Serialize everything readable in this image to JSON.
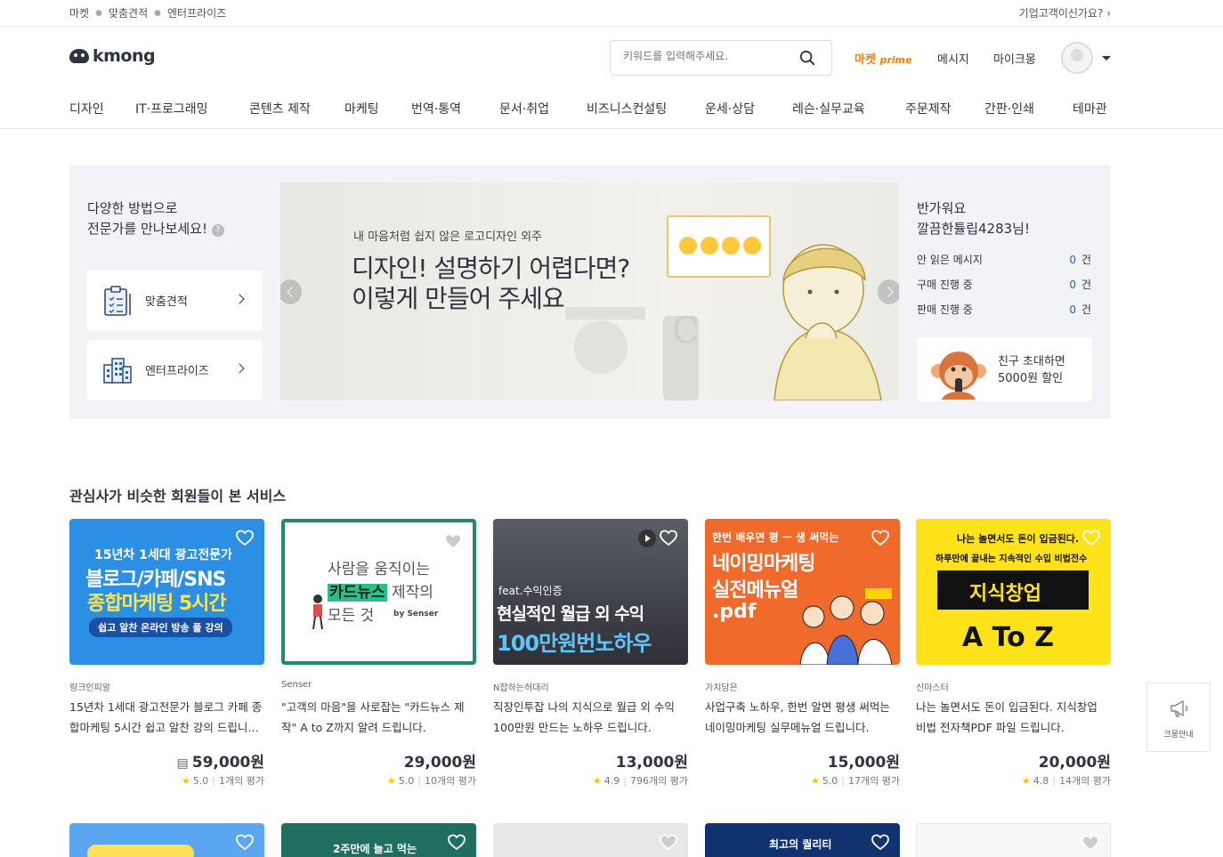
{
  "topbar": {
    "crumbs": [
      "마켓",
      "맞춤견적",
      "엔터프라이즈"
    ],
    "enterprise_q": "기업고객이신가요?"
  },
  "header": {
    "logo": "kmong",
    "search_placeholder": "키워드를 입력해주세요.",
    "market": "마켓",
    "prime": "prime",
    "messages": "메시지",
    "mykmong": "마이크몽"
  },
  "categories": [
    "디자인",
    "IT·프로그래밍",
    "콘텐츠 제작",
    "마케팅",
    "번역·통역",
    "문서·취업",
    "비즈니스컨설팅",
    "운세·상담",
    "레슨·실무교육",
    "주문제작",
    "간판·인쇄",
    "테마관"
  ],
  "hero": {
    "left_title_1": "다양한 방법으로",
    "left_title_2": "전문가를 만나보세요!",
    "help": "?",
    "quick1": "맞춤견적",
    "quick2": "엔터프라이즈",
    "banner_sub": "내 마음처럼 쉽지 않은 로고디자인 외주",
    "banner_line1": "디자인! 설명하기 어렵다면?",
    "banner_line2": "이렇게 만들어 주세요",
    "welcome_1": "반가워요",
    "welcome_2": "깔끔한튤립4283님!",
    "stats": [
      {
        "label": "안 읽은 메시지",
        "value": "0",
        "unit": "건"
      },
      {
        "label": "구매 진행 중",
        "value": "0",
        "unit": "건"
      },
      {
        "label": "판매 진행 중",
        "value": "0",
        "unit": "건"
      }
    ],
    "invite_1": "친구 초대하면",
    "invite_2": "5000원 할인"
  },
  "section": {
    "title": "관심사가 비슷한 회원들이 본 서비스"
  },
  "cards": [
    {
      "seller": "링크인피알",
      "title": "15년차 1세대 광고전문가 블로그 카페 종합마케팅 5시간 쉽고 알찬 강의 드립니…",
      "price": "59,000원",
      "rating": "5.0",
      "reviews": "1개의 평가",
      "thumb_1": "15년차 1세대 광고전문가",
      "thumb_2": "블로그/카페/SNS",
      "thumb_3": "종합마케팅 5시간",
      "thumb_4": "쉽고 알찬 온라인 방송 풀 강의",
      "bg": "#2b8fe3"
    },
    {
      "seller": "Senser",
      "title": "\"고객의 마음\"을 사로잡는 \"카드뉴스 제작\" A to Z까지 알려 드립니다.",
      "price": "29,000원",
      "rating": "5.0",
      "reviews": "10개의 평가",
      "thumb_1": "사람을 움직이는",
      "thumb_2": "카드뉴스",
      "thumb_2b": " 제작의",
      "thumb_3": "모든 것",
      "thumb_4": "by Senser",
      "bg": "#ffffff"
    },
    {
      "seller": "N잡하는허대리",
      "title": "직장인투잡 나의 지식으로 월급 외 수익 100만원 만드는 노하우 드립니다.",
      "price": "13,000원",
      "rating": "4.9",
      "reviews": "796개의 평가",
      "thumb_1": "feat.수익인증",
      "thumb_2": "현실적인 월급 외 수익",
      "thumb_3": "100만원번노하우",
      "bg": "#3a3d44"
    },
    {
      "seller": "가치담은",
      "title": "사업구축 노하우, 한번 알면 평생 써먹는 네이밍마케팅 실무메뉴얼 드립니다.",
      "price": "15,000원",
      "rating": "5.0",
      "reviews": "17개의 평가",
      "thumb_1": "한번 배우면 평 ㅡ 생 써먹는",
      "thumb_2": "네이밍마케팅",
      "thumb_3": "실전메뉴얼",
      "thumb_4": ".pdf",
      "bg": "#f06a2c"
    },
    {
      "seller": "신마스터",
      "title": "나는 놀면서도 돈이 입금된다. 지식창업 비법 전자책PDF 파일 드립니다.",
      "price": "20,000원",
      "rating": "4.8",
      "reviews": "14개의 평가",
      "thumb_1": "나는 놀면서도 돈이 입금된다.",
      "thumb_2": "하루만에 끝내는 지속적인 수입 비법전수",
      "thumb_3": "지식창업",
      "thumb_4": "A To Z",
      "bg": "#ffe21a"
    }
  ],
  "row2": [
    {
      "text": "",
      "bg": "#5aa6f0"
    },
    {
      "text": "2주만에 늘고 먹는",
      "bg": "#1f6e5f"
    },
    {
      "text": "",
      "bg": "#e8e8ea"
    },
    {
      "text": "최고의 퀄리티",
      "bg": "#10326e"
    },
    {
      "text": "",
      "bg": "#f7f7f9"
    }
  ],
  "side_help": "크몽안내"
}
